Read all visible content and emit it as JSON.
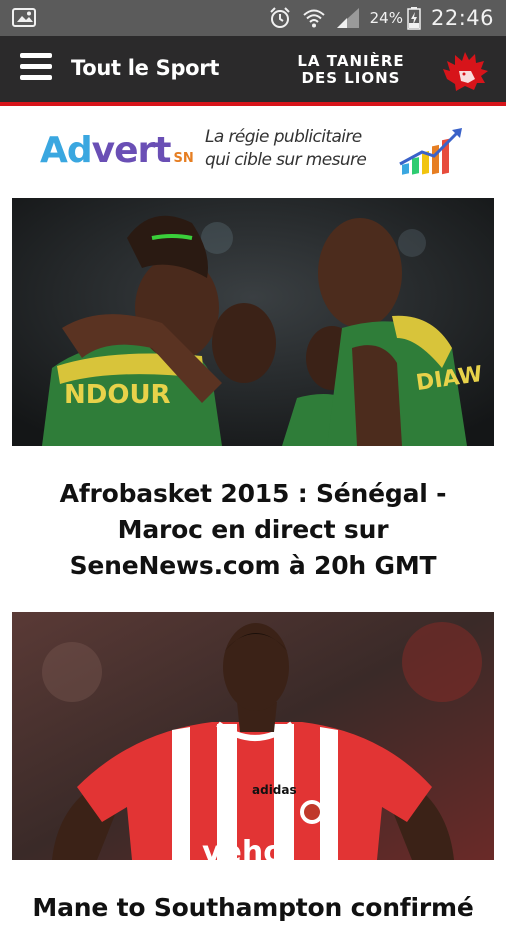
{
  "status_bar": {
    "battery_percent": "24%",
    "time": "22:46",
    "icons": [
      "screenshot-icon",
      "alarm-clock-icon",
      "wifi-icon",
      "signal-icon",
      "battery-charging-icon"
    ]
  },
  "app_bar": {
    "title": "Tout le Sport",
    "brand_line1": "LA TANIÈRE",
    "brand_line2": "DES LIONS",
    "accent_color": "#d7141a",
    "background_color": "#2b2a2b"
  },
  "advert": {
    "name_part1": "Ad",
    "name_part2": "vert",
    "name_suffix": "SN",
    "slogan_line1": "La régie publicitaire",
    "slogan_line2": "qui cible sur mesure"
  },
  "articles": [
    {
      "title": "Afrobasket 2015 : Sénégal - Maroc en direct sur SeneNews.com à 20h GMT",
      "jersey_text_left": "NDOUR",
      "jersey_text_right": "DIAW"
    },
    {
      "title": "Mane to Southampton confirmé",
      "jersey_sponsor": "veho"
    }
  ]
}
